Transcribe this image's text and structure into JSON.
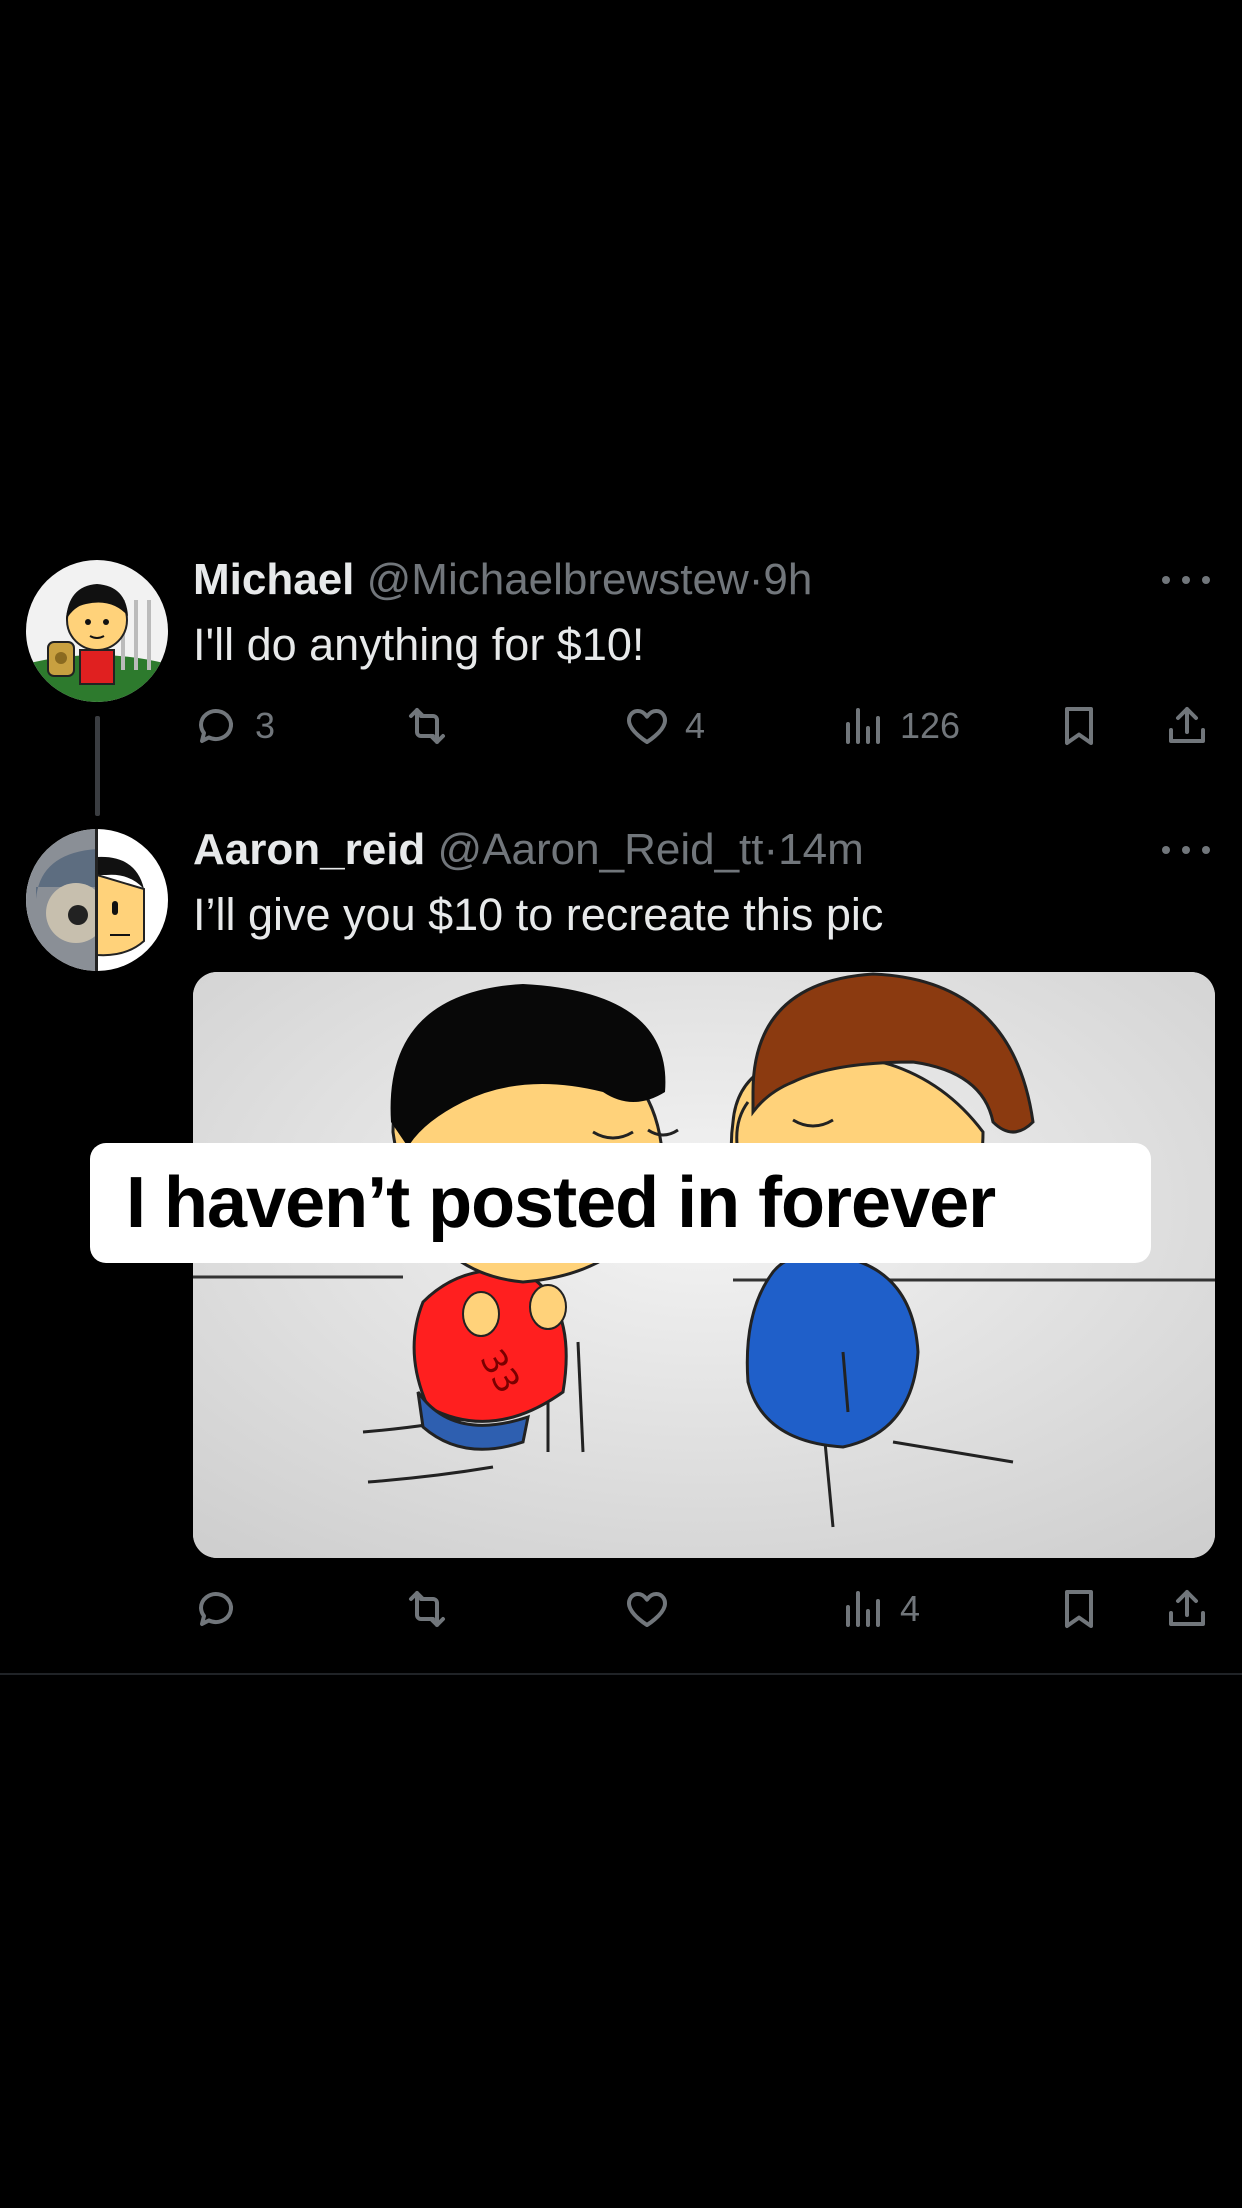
{
  "tweets": [
    {
      "name": "Michael",
      "handle": "@Michaelbrewstew",
      "separator": "·",
      "time": "9h",
      "text": "I'll do anything for $10!",
      "replies": "3",
      "reposts": "",
      "likes": "4",
      "views": "126"
    },
    {
      "name": "Aaron_reid",
      "handle": "@Aaron_Reid_tt",
      "separator": "·",
      "time": "14m",
      "text": "I’ll give you $10 to recreate this pic",
      "replies": "",
      "reposts": "",
      "likes": "",
      "views": "4"
    }
  ],
  "media": {
    "shirt_text": "33"
  },
  "overlay": {
    "caption": "I haven’t posted in forever"
  },
  "icons": {
    "reply": "reply-icon",
    "repost": "repost-icon",
    "like": "heart-icon",
    "views": "views-chart-icon",
    "bookmark": "bookmark-icon",
    "share": "share-icon",
    "more": "more-dots-icon"
  },
  "colors": {
    "background": "#000000",
    "primary_text": "#e7e9ea",
    "secondary_text": "#71767b",
    "shirt_red": "#ff1f1f",
    "hoodie_blue": "#1f5fc9",
    "skin": "#ffd27a",
    "hair_brown": "#8b3a10"
  }
}
